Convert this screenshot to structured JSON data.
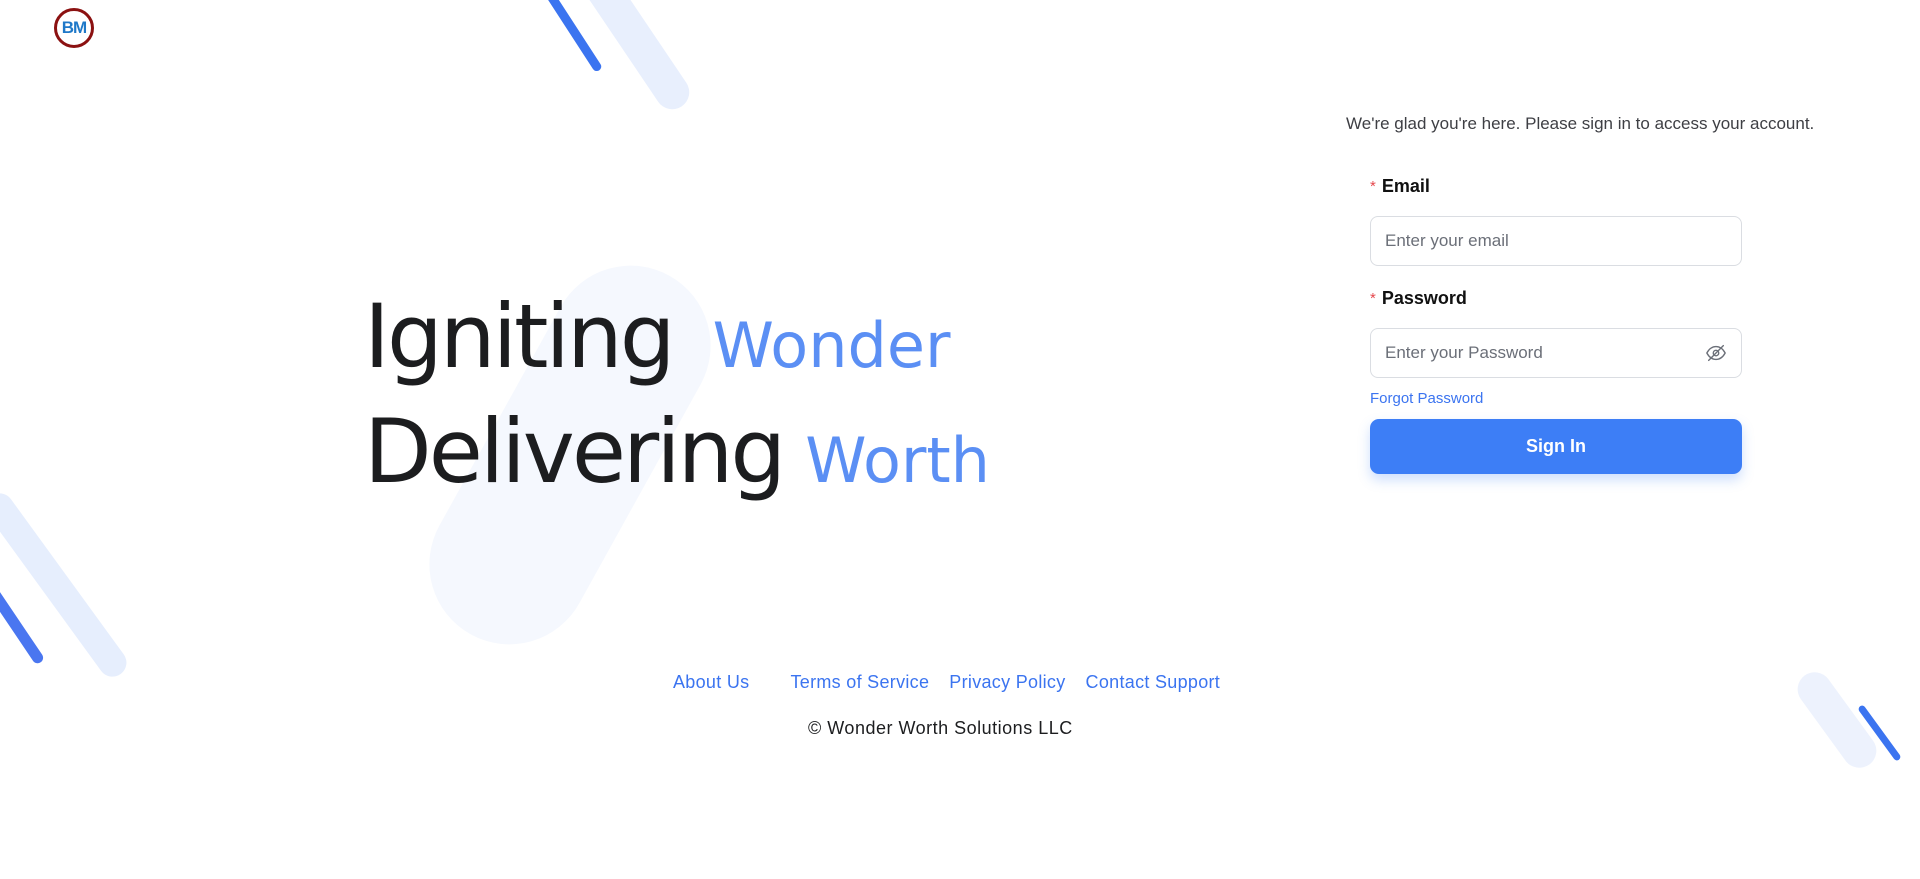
{
  "logo": {
    "text": "BM"
  },
  "hero": {
    "line1_main": "Igniting",
    "line1_accent": "Wonder",
    "line2_main": "Delivering",
    "line2_accent": "Worth"
  },
  "signin": {
    "welcome": "We're glad you're here. Please sign in to access your account.",
    "email_label": "Email",
    "email_placeholder": "Enter your email",
    "email_value": "",
    "password_label": "Password",
    "password_placeholder": "Enter your Password",
    "password_value": "",
    "required_marker": "*",
    "forgot_link": "Forgot Password",
    "submit_label": "Sign In",
    "toggle_icon": "eye-slash-icon"
  },
  "footer": {
    "links": [
      "About Us",
      "Terms of Service",
      "Privacy Policy",
      "Contact Support"
    ],
    "copyright": "© Wonder Worth Solutions LLC"
  },
  "colors": {
    "accent": "#3d7ef6",
    "hero_accent": "#5b8ff4",
    "logo_ring": "#8b1111",
    "logo_text": "#1e78c8",
    "required": "#e5484d"
  }
}
